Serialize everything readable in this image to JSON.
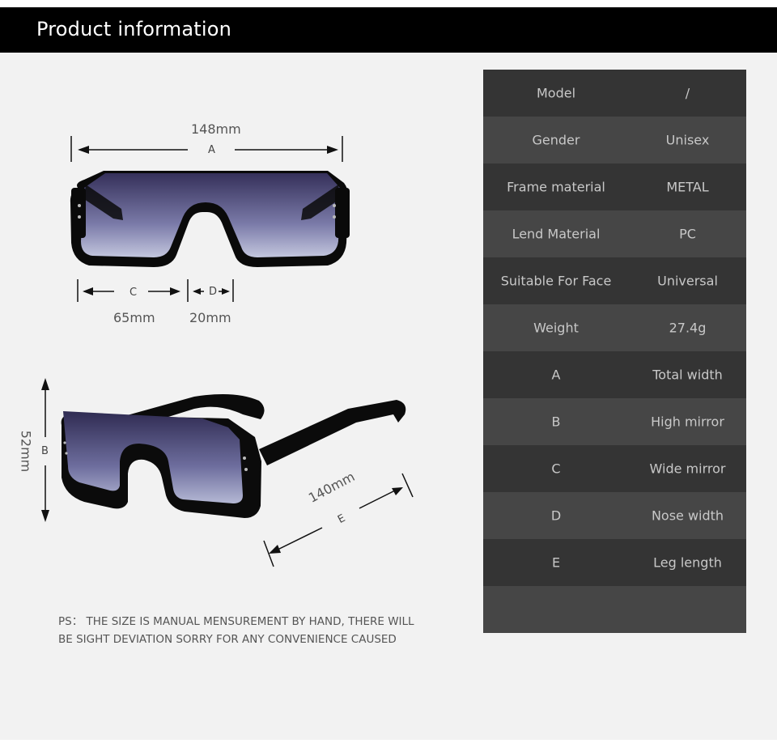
{
  "header": {
    "title": "Product information"
  },
  "front_view": {
    "total_width": {
      "letter": "A",
      "value": "148mm"
    },
    "lens_width": {
      "letter": "C",
      "value": "65mm"
    },
    "nose_width": {
      "letter": "D",
      "value": "20mm"
    }
  },
  "side_view": {
    "height": {
      "letter": "B",
      "value": "52mm"
    },
    "leg_length": {
      "letter": "E",
      "value": "140mm"
    }
  },
  "note": {
    "line1": "PS： THE SIZE IS MANUAL MENSUREMENT BY HAND, THERE WILL",
    "line2": "BE SIGHT DEVIATION SORRY FOR ANY CONVENIENCE CAUSED"
  },
  "specs": [
    {
      "key": "Model",
      "value": "/"
    },
    {
      "key": "Gender",
      "value": "Unisex"
    },
    {
      "key": "Frame material",
      "value": "METAL"
    },
    {
      "key": "Lend Material",
      "value": "PC"
    },
    {
      "key": "Suitable For Face",
      "value": "Universal"
    },
    {
      "key": "Weight",
      "value": "27.4g"
    },
    {
      "key": "A",
      "value": "Total width"
    },
    {
      "key": "B",
      "value": "High mirror"
    },
    {
      "key": "C",
      "value": "Wide mirror"
    },
    {
      "key": "D",
      "value": "Nose width"
    },
    {
      "key": "E",
      "value": "Leg length"
    },
    {
      "key": "",
      "value": ""
    }
  ],
  "colors": {
    "header_bg": "#000000",
    "page_bg": "#f2f2f2",
    "row_dark": "#343434",
    "row_light": "#464646",
    "lens_top": "#3a3560",
    "lens_bottom": "#b8bcd8"
  }
}
